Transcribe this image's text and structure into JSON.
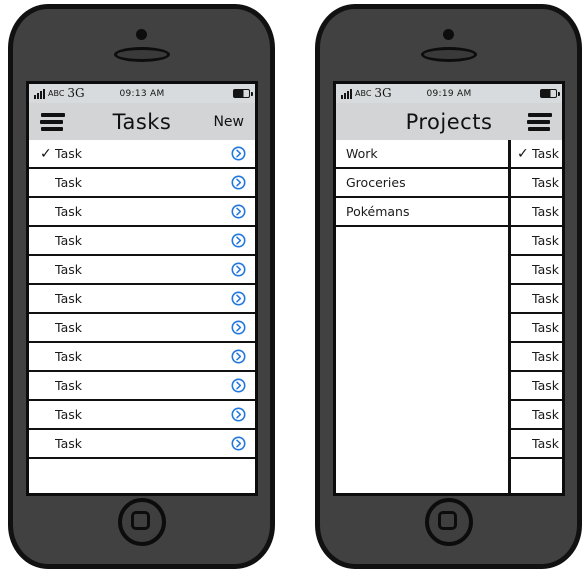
{
  "accent_blue": "#2277dd",
  "phones": {
    "left": {
      "name": "tasks-screen",
      "status_bar": {
        "signal_icon": "signal-bars-icon",
        "carrier": "ABC",
        "network": "3G",
        "time": "09:13 AM",
        "battery_icon": "battery-icon"
      },
      "nav_bar": {
        "menu_icon": "hamburger-menu-icon",
        "title": "Tasks",
        "action_label": "New"
      },
      "list": {
        "disclosure_icon": "chevron-right-circle-icon",
        "check_glyph": "✓",
        "rows": [
          {
            "label": "Task",
            "checked": true
          },
          {
            "label": "Task",
            "checked": false
          },
          {
            "label": "Task",
            "checked": false
          },
          {
            "label": "Task",
            "checked": false
          },
          {
            "label": "Task",
            "checked": false
          },
          {
            "label": "Task",
            "checked": false
          },
          {
            "label": "Task",
            "checked": false
          },
          {
            "label": "Task",
            "checked": false
          },
          {
            "label": "Task",
            "checked": false
          },
          {
            "label": "Task",
            "checked": false
          },
          {
            "label": "Task",
            "checked": false
          }
        ]
      }
    },
    "right": {
      "name": "projects-drawer-screen",
      "status_bar": {
        "signal_icon": "signal-bars-icon",
        "carrier": "ABC",
        "network": "3G",
        "time": "09:19 AM",
        "battery_icon": "battery-icon"
      },
      "nav_bar": {
        "title": "Projects",
        "menu_icon": "hamburger-menu-icon"
      },
      "drawer": {
        "items": [
          {
            "label": "Work"
          },
          {
            "label": "Groceries"
          },
          {
            "label": "Pokémans"
          }
        ]
      },
      "peek_list": {
        "check_glyph": "✓",
        "rows": [
          {
            "label": "Task",
            "checked": true
          },
          {
            "label": "Task",
            "checked": false
          },
          {
            "label": "Task",
            "checked": false
          },
          {
            "label": "Task",
            "checked": false
          },
          {
            "label": "Task",
            "checked": false
          },
          {
            "label": "Task",
            "checked": false
          },
          {
            "label": "Task",
            "checked": false
          },
          {
            "label": "Task",
            "checked": false
          },
          {
            "label": "Task",
            "checked": false
          },
          {
            "label": "Task",
            "checked": false
          },
          {
            "label": "Task",
            "checked": false
          }
        ]
      }
    }
  },
  "hardware": {
    "camera_icon": "camera-dot-icon",
    "speaker_icon": "earpiece-speaker-icon",
    "home_button_icon": "home-button-icon"
  }
}
